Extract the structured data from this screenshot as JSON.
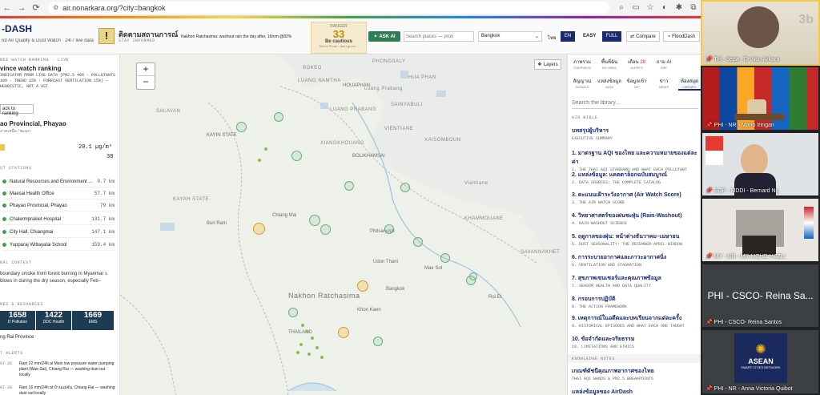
{
  "browser": {
    "url": "air.nonarkara.org/?city=bangkok"
  },
  "header": {
    "logo": "-DASH",
    "tagline": "nd Air Quality & Dust Watch · 24/7 live data",
    "warn_title": "ติดตามสถานการณ์",
    "warn_sub": "STAY INFORMED",
    "ticker": "Nakhon Ratchasima: washout rain the day after, 16mm @82%",
    "danger_label": "DANGER",
    "danger_value": "33",
    "danger_status": "Be cautious",
    "danger_sub": "Select Phrae • alert groun...",
    "ask_label": "ASK AI",
    "search_placeholder": "Search places — prov",
    "city": "Bangkok",
    "lang_th": "ไทย",
    "lang_en": "EN",
    "easy": "EASY",
    "full": "FULL",
    "compare": "Compare",
    "flood": "FloodDash"
  },
  "left": {
    "watch_title": "NCE WATCH RANKING · LIVE",
    "ranking": "vince watch ranking",
    "desc": "INDICATOR FROM LIVE DATA (PM2.5 40% · POLLUTANTS 10% · TREND 15% · FORECAST VENTILATION 15%) — HEURISTIC, NOT A AST",
    "back": "ack to ranking",
    "place": "ao Provincial, Phayao",
    "place_sub": "ภาคเหนือ / พะเยา",
    "pm_value": "20.1 µg/m³",
    "aqi": "38",
    "stations_title": "ST STATIONS",
    "stations": [
      {
        "name": "Natural Resources and Environment ...",
        "dist": "0.7 km"
      },
      {
        "name": "Maesai Health Office",
        "dist": "57.7 km"
      },
      {
        "name": "Phayao Provincial, Phayao",
        "dist": "79 km"
      },
      {
        "name": "Chalermprakiet Hospital",
        "dist": "131.7 km"
      },
      {
        "name": "City Hall, Chiangmai",
        "dist": "147.1 km"
      },
      {
        "name": "Yupparaj Wittayalai School",
        "dist": "159.4 km"
      }
    ],
    "context_title": "NAL CONTEXT",
    "context_text": "boundary smoke from forest burning in Myanmar s blows in during the dry season, especially Feb–",
    "res_title": "MES & RESOURCES",
    "stats": [
      {
        "value": "1658",
        "label": "D Pollution"
      },
      {
        "value": "1422",
        "label": "DDC Health"
      },
      {
        "value": "1669",
        "label": "EMS"
      }
    ],
    "hotline": "ng Rai Province",
    "alerts_title": "T ALERTS",
    "alerts": [
      {
        "date": "07-26",
        "text": "Rain 22 mm/24h at Main low pressure water pumping plant (Wae Sai), Chiang Rai — washing dust out locally"
      },
      {
        "date": "07-28",
        "text": "Rain 16 mm/24h at บ้านแม่จัน, Chiang Rai — washing dust out locally"
      }
    ]
  },
  "map": {
    "layers": "Layers",
    "labels": [
      "BOKEO",
      "LUANG NAMTHA",
      "PHONGSALY",
      "HUA PHAN",
      "HOUAPHAN",
      "Luang Prabang",
      "LUANG PRABANG",
      "SAINYABULI",
      "XIANGKHOUANG",
      "VIENTIANE",
      "XAISOMBOUN",
      "BOLIKHAMSAI",
      "Vientiane",
      "KHAMMOUANE",
      "SAVANNAKHET",
      "SALAVAN",
      "KAYAH STATE",
      "KAYIN STATE",
      "Chiang Mai",
      "Phitsanulok",
      "Udon Thani",
      "Khon Kaen",
      "Nakhon Ratchasima",
      "THAILAND",
      "Bangkok",
      "Buri Ram",
      "Mae Sot",
      "Roi Et",
      "Ubon"
    ],
    "zoom_in": "+",
    "zoom_out": "−"
  },
  "library": {
    "tabs": [
      {
        "th": "ภาพรวม",
        "en": "OVERVIEW"
      },
      {
        "th": "พื้นที่ฉัน",
        "en": "MY AREA"
      },
      {
        "th": "เตือน",
        "en": "ALERTS",
        "badge": "28"
      },
      {
        "th": "ถาม AI",
        "en": "ASK"
      },
      {
        "th": "สัญญาณ",
        "en": "SIGNALS"
      },
      {
        "th": "แหล่งข้อมูล",
        "en": "DATA"
      },
      {
        "th": "ข้อมูลเข้า",
        "en": "TAP"
      },
      {
        "th": "ข่าว",
        "en": "NEWS"
      },
      {
        "th": "ห้องสมุด",
        "en": "LIBRARY"
      }
    ],
    "search": "Search the library...",
    "section": "AIR BIBLE",
    "items": [
      {
        "th": "บทสรุปผู้บริหาร",
        "en": "EXECUTIVE SUMMARY"
      },
      {
        "th": "1. มาตรฐาน AQI ของไทย และความหมายของแต่ละค่า",
        "en": "1. THE THAI AQI STANDARD AND WHAT EACH POLLUTANT"
      },
      {
        "th": "2. แหล่งข้อมูล: แคตตาล็อกฉบับสมบูรณ์",
        "en": "2. DATA SOURCES: THE COMPLETE CATALOG"
      },
      {
        "th": "3. คะแนนเฝ้าระวังอากาศ (Air Watch Score)",
        "en": "3. THE AIR WATCH SCORE"
      },
      {
        "th": "4. วิทยาศาสตร์ของฝนชะฝุ่น (Rain-Washout)",
        "en": "4. RAIN-WASHOUT SCIENCE"
      },
      {
        "th": "5. ฤดูกาลของฝุ่น: หน้าต่างธันวาคม–เมษายน",
        "en": "5. DUST SEASONALITY: THE DECEMBER–APRIL WINDOW"
      },
      {
        "th": "6. การระบายอากาศและภาวะอากาศนิ่ง",
        "en": "6. VENTILATION AND STAGNATION"
      },
      {
        "th": "7. สุขภาพเซนเซอร์และคุณภาพข้อมูล",
        "en": "7. SENSOR HEALTH AND DATA QUALITY"
      },
      {
        "th": "8. กรอบการปฏิบัติ",
        "en": "8. THE ACTION FRAMEWORK"
      },
      {
        "th": "9. เหตุการณ์ในอดีตและบทเรียนจากแต่ละครั้ง",
        "en": "9. HISTORICAL EPISODES AND WHAT EACH ONE TAUGHT"
      },
      {
        "th": "10. ข้อจำกัดและจริยธรรม",
        "en": "10. LIMITATIONS AND ETHICS"
      }
    ],
    "notes_title": "KNOWLEDGE NOTES",
    "notes": [
      {
        "th": "เกณฑ์ดัชนีคุณภาพอากาศของไทย",
        "en": "THAI AQI BANDS & PM2.5 BREAKPOINTS"
      },
      {
        "th": "แหล่งข้อมูลของ AirDash",
        "en": ""
      }
    ]
  },
  "participants": [
    {
      "label": "TH - depa - Dr Non Arkara"
    },
    {
      "label": "PHI - NR - Mario Iringan"
    },
    {
      "label": "SGP - MDDI - Bernard Ng"
    },
    {
      "label": "MY - NR - MR MOHD HAZLI"
    },
    {
      "label": "PHI - CSCO- Reina Sa...",
      "sub": "PHI - CSCO- Reina Santos"
    },
    {
      "label": "PHI - NR - Anna Victoria Quibot",
      "logo": "ASEAN",
      "logo_sub": "SMART CITIES NETWORK"
    }
  ]
}
